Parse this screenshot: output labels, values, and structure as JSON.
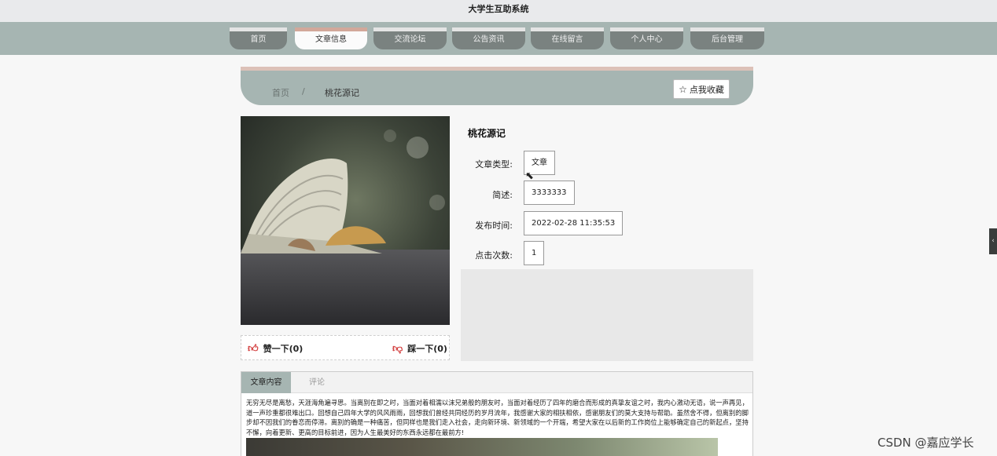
{
  "site": {
    "title": "大学生互助系统"
  },
  "nav": [
    {
      "label": "首页",
      "active": false
    },
    {
      "label": "文章信息",
      "active": true
    },
    {
      "label": "交流论坛",
      "active": false
    },
    {
      "label": "公告资讯",
      "active": false
    },
    {
      "label": "在线留言",
      "active": false
    },
    {
      "label": "个人中心",
      "active": false
    },
    {
      "label": "后台管理",
      "active": false
    }
  ],
  "breadcrumb": {
    "home": "首页",
    "separator": "/",
    "current": "桃花源记"
  },
  "favorite": {
    "icon": "star-outline-icon",
    "label": "点我收藏"
  },
  "article": {
    "title": "桃花源记",
    "fields": [
      {
        "label": "文章类型:",
        "value": "文章"
      },
      {
        "label": "简述:",
        "value": "3333333"
      },
      {
        "label": "发布时间:",
        "value": "2022-02-28 11:35:53"
      },
      {
        "label": "点击次数:",
        "value": "1"
      }
    ]
  },
  "votes": {
    "like_label": "赞一下(0)",
    "dislike_label": "踩一下(0)"
  },
  "tabs": {
    "content": "文章内容",
    "comment": "评论"
  },
  "content": {
    "paragraph": "无穷无尽是离愁，天涯海角遍寻思。当离别在即之时，当面对着相濡以沫兄弟般的朋友时，当面对着经历了四年的磨合而形成的真挚友谊之时，我内心激动无语，说一声再见，道一声珍重都很难出口。回想自己四年大学的风风雨雨，回想我们曾经共同经历的岁月流年，我感谢大家的相扶相依，感谢朋友们的莫大支持与帮助。虽然舍不得，但离别的脚步却不因我们的眷恋而停滞。离别的确是一种痛苦，但同样也是我们走入社会，走向新环境、新领域的一个开端，希望大家在以后新的工作岗位上能够确定自己的新起点，坚持不懈，向着更新、更高的目标前进，因为人生最美好的东西永远都在最前方!"
  },
  "watermark": "CSDN @嘉应学长",
  "colors": {
    "band": "#a6b5b2",
    "accent": "#d2a89a",
    "like": "#d23a3a"
  }
}
